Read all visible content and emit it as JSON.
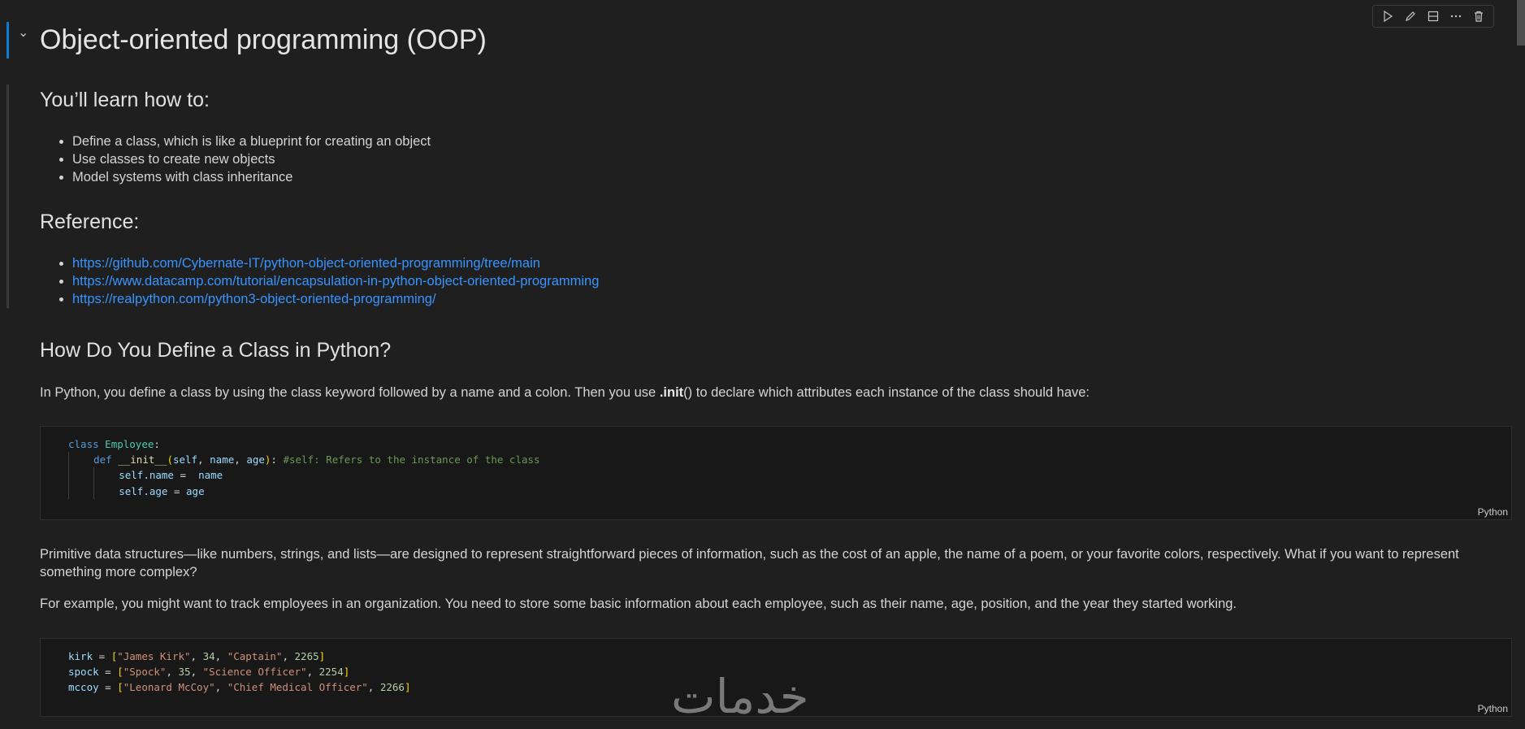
{
  "cell": {
    "title": "Object-oriented programming (OOP)",
    "learn_heading": "You’ll learn how to:",
    "learn_items": [
      "Define a class, which is like a blueprint for creating an object",
      "Use classes to create new objects",
      "Model systems with class inheritance"
    ],
    "reference_heading": "Reference:",
    "reference_links": [
      "https://github.com/Cybernate-IT/python-object-oriented-programming/tree/main",
      "https://www.datacamp.com/tutorial/encapsulation-in-python-object-oriented-programming",
      "https://realpython.com/python3-object-oriented-programming/"
    ],
    "define_heading": "How Do You Define a Class in Python?",
    "define_para_before": "In Python, you define a class by using the class keyword followed by a name and a colon. Then you use ",
    "define_para_bold": ".init",
    "define_para_after": "() to declare which attributes each instance of the class should have:",
    "primitive_para": "Primitive data structures—like numbers, strings, and lists—are designed to represent straightforward pieces of information, such as the cost of an apple, the name of a poem, or your favorite colors, respectively. What if you want to represent something more complex?",
    "example_para": "For example, you might want to track employees in an organization. You need to store some basic information about each employee, such as their name, age, position, and the year they started working."
  },
  "code1": {
    "lang": "Python",
    "class_kw": "class",
    "class_name": "Employee",
    "colon": ":",
    "def_kw": "def",
    "init_name": "__init__",
    "self": "self",
    "name_param": "name",
    "age_param": "age",
    "comment": "#self: Refers to the instance of the class",
    "line3_attr": "name",
    "line3_val": "name",
    "line4_attr": "age",
    "line4_val": "age"
  },
  "code2": {
    "lang": "Python",
    "rows": [
      {
        "var": "kirk",
        "s1": "\"James Kirk\"",
        "n1": "34",
        "s2": "\"Captain\"",
        "n2": "2265"
      },
      {
        "var": "spock",
        "s1": "\"Spock\"",
        "n1": "35",
        "s2": "\"Science Officer\"",
        "n2": "2254"
      },
      {
        "var": "mccoy",
        "s1": "\"Leonard McCoy\"",
        "n1": "\"Chief Medical Officer\"",
        "n2": "2266"
      }
    ]
  },
  "watermark": "خدمات"
}
